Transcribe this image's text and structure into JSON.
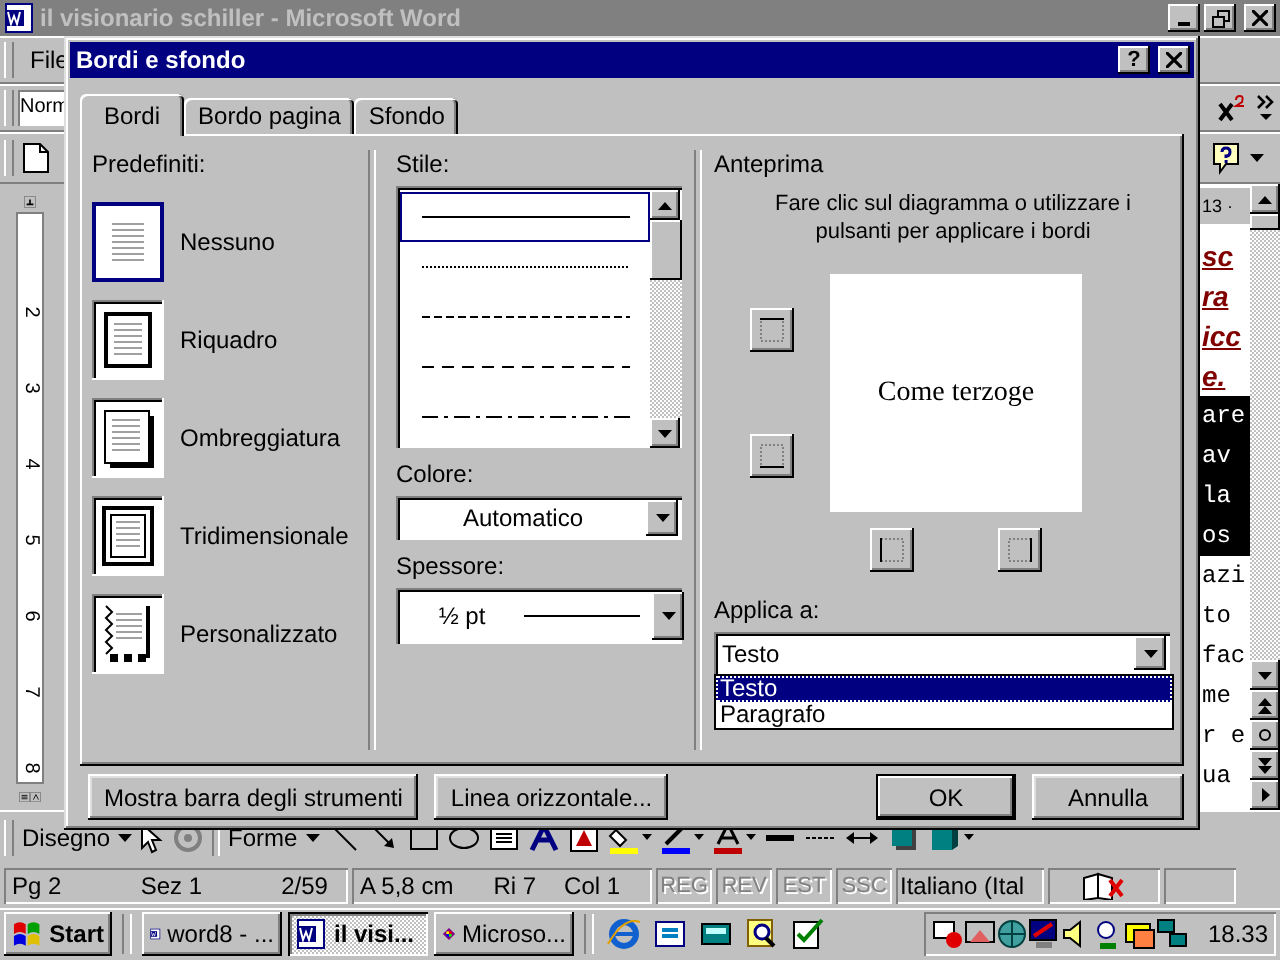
{
  "word_window": {
    "title": "il visionario schiller - Microsoft Word",
    "menu": [
      "File"
    ],
    "style_box": "Norm"
  },
  "vertical_ruler": [
    "2",
    "3",
    "4",
    "5",
    "6",
    "7",
    "8"
  ],
  "document": {
    "ruler_text": "13 ·",
    "lines": [
      {
        "text": "sc",
        "kind": "heading"
      },
      {
        "text": "ra",
        "kind": "heading"
      },
      {
        "text": "icc",
        "kind": "heading"
      },
      {
        "text": "e.",
        "kind": "heading"
      },
      {
        "text": "are",
        "kind": "selected"
      },
      {
        "text": "av",
        "kind": "selected"
      },
      {
        "text": "la",
        "kind": "selected"
      },
      {
        "text": "os",
        "kind": "selected"
      },
      {
        "text": "azi",
        "kind": "plain"
      },
      {
        "text": "to",
        "kind": "plain"
      },
      {
        "text": "fac",
        "kind": "plain"
      },
      {
        "text": "me",
        "kind": "plain"
      },
      {
        "text": "r e",
        "kind": "plain"
      },
      {
        "text": "ua",
        "kind": "plain"
      }
    ]
  },
  "dialog": {
    "title": "Bordi e sfondo",
    "help": "?",
    "tabs": [
      {
        "label": "Bordi",
        "selected": true
      },
      {
        "label": "Bordo pagina",
        "selected": false
      },
      {
        "label": "Sfondo",
        "selected": false
      }
    ],
    "presets": {
      "label": "Predefiniti:",
      "items": [
        {
          "label": "Nessuno",
          "kind": "none",
          "selected": true
        },
        {
          "label": "Riquadro",
          "kind": "box",
          "selected": false
        },
        {
          "label": "Ombreggiatura",
          "kind": "shadow",
          "selected": false
        },
        {
          "label": "Tridimensionale",
          "kind": "relief",
          "selected": false
        },
        {
          "label": "Personalizzato",
          "kind": "custom",
          "selected": false
        }
      ]
    },
    "style": {
      "label": "Stile:",
      "lines": [
        {
          "kind": "solid",
          "selected": true
        },
        {
          "kind": "dotted",
          "selected": false
        },
        {
          "kind": "dashed-fine",
          "selected": false
        },
        {
          "kind": "dashed",
          "selected": false
        },
        {
          "kind": "dash-dot",
          "selected": false
        }
      ]
    },
    "color": {
      "label": "Colore:",
      "value": "Automatico"
    },
    "width": {
      "label": "Spessore:",
      "value": "½ pt"
    },
    "preview": {
      "label": "Anteprima",
      "hint_lines": [
        "Fare clic sul diagramma o utilizzare i",
        "pulsanti per applicare i bordi"
      ],
      "sample": "Come terzoge",
      "side_buttons": [
        {
          "kind": "top"
        },
        {
          "kind": "bottom"
        }
      ],
      "bottom_buttons": [
        {
          "kind": "left"
        },
        {
          "kind": "right"
        }
      ]
    },
    "apply_to": {
      "label": "Applica a:",
      "value": "Testo",
      "options": [
        {
          "label": "Testo",
          "selected": true
        },
        {
          "label": "Paragrafo",
          "selected": false
        }
      ]
    },
    "buttons": [
      {
        "label": "Mostra barra degli strumenti",
        "kind": "left"
      },
      {
        "label": "Linea orizzontale...",
        "kind": "left"
      },
      {
        "label": "OK",
        "kind": "default"
      },
      {
        "label": "Annulla",
        "kind": "right"
      }
    ]
  },
  "drawing_toolbar": {
    "menus": [
      "Disegno",
      "Forme"
    ]
  },
  "status_bar": {
    "position": [
      "Pg  2",
      "Sez  1",
      "2/59"
    ],
    "location": [
      "A  5,8 cm",
      "Ri  7",
      "Col  1"
    ],
    "modes": [
      {
        "label": "REG",
        "disabled": true
      },
      {
        "label": "REV",
        "disabled": true
      },
      {
        "label": "EST",
        "disabled": true
      },
      {
        "label": "SSC",
        "disabled": true
      }
    ],
    "language": "Italiano (Ital"
  },
  "taskbar": {
    "start": "Start",
    "tasks": [
      {
        "label": "word8 - ...",
        "kind": "word",
        "selected": false
      },
      {
        "label": "il visi...",
        "kind": "word",
        "selected": true
      },
      {
        "label": "Microso...",
        "kind": "paint",
        "selected": false
      }
    ],
    "clock": "18.33"
  }
}
